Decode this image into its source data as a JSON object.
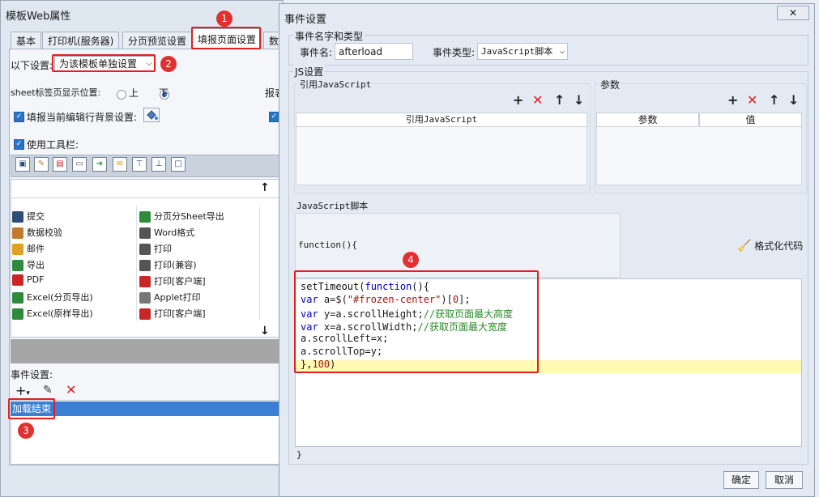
{
  "left_window": {
    "title": "模板Web属性",
    "tabs": [
      {
        "label": "基本"
      },
      {
        "label": "打印机(服务器)"
      },
      {
        "label": "分页预览设置"
      },
      {
        "label": "填报页面设置"
      },
      {
        "label": "数"
      }
    ],
    "setting_label": "以下设置:",
    "setting_value": "为该模板单独设置",
    "sheet_tab_label": "sheet标签页显示位置:",
    "radio_top": "上",
    "radio_bottom": "下",
    "report_label_partial": "报表",
    "fill_bg_label": "填报当前编辑行背景设置:",
    "use_toolbar_label": "使用工具栏:",
    "items_col1": [
      "提交",
      "数据校验",
      "邮件",
      "导出",
      "PDF",
      "Excel(分页导出)",
      "Excel(原样导出)"
    ],
    "items_col2": [
      "分页分Sheet导出",
      "Word格式",
      "打印",
      "打印(兼容)",
      "打印[客户端]",
      "Applet打印",
      "打印[客户端]"
    ],
    "event_label": "事件设置:",
    "event_item": "加载结束"
  },
  "badges": [
    "1",
    "2",
    "3",
    "4"
  ],
  "dialog": {
    "title": "事件设置",
    "group_name_type": "事件名字和类型",
    "event_name_label": "事件名:",
    "event_name_value": "afterload",
    "event_type_label": "事件类型:",
    "event_type_value": "JavaScript脚本",
    "js_group": "JS设置",
    "ref_js_label": "引用JavaScript",
    "params_label": "参数",
    "ref_js_header": "引用JavaScript",
    "params_header": "参数",
    "value_header": "值",
    "script_label": "JavaScript脚本",
    "function_open": "function(){",
    "format_code": "格式化代码",
    "code_lines": [
      "setTimeout(function(){",
      "var a=$(\"#frozen-center\")[0];",
      "var y=a.scrollHeight;//获取页面最大高度",
      "var x=a.scrollWidth;//获取页面最大宽度",
      "a.scrollLeft=x;",
      "a.scrollTop=y;",
      "},100)"
    ],
    "function_close": "}",
    "ok_button": "确定",
    "cancel_button": "取消"
  },
  "colors": {
    "accent": "#e02020",
    "selection": "#3b7fd4",
    "code_highlight": "#fff9b3"
  }
}
